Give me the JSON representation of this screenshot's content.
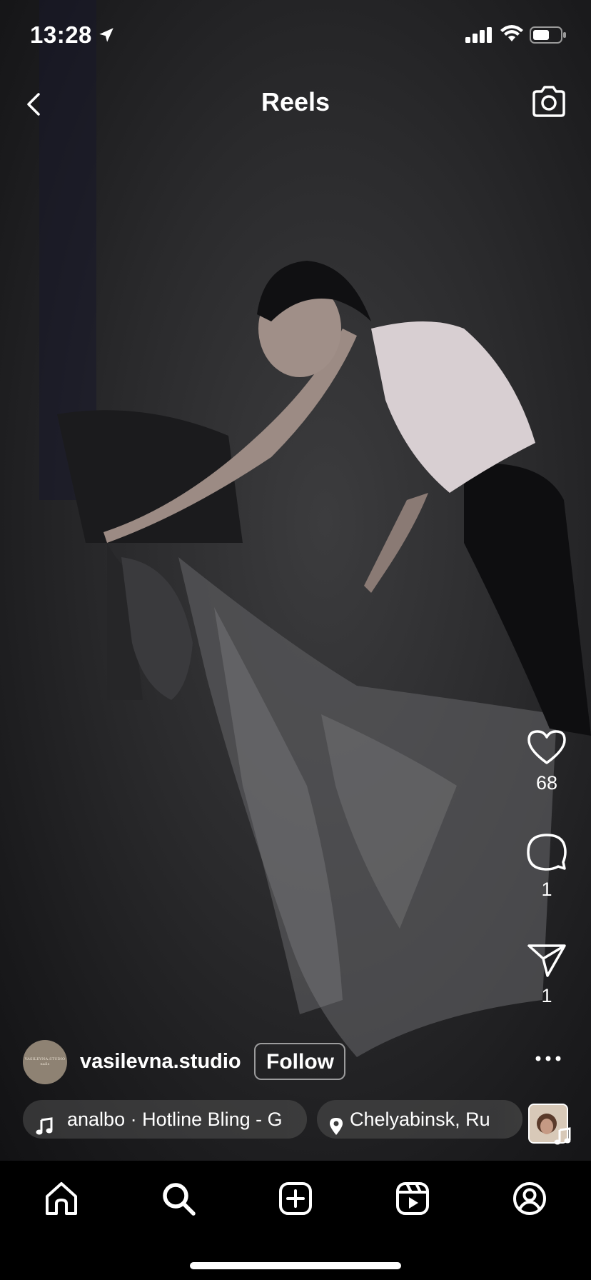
{
  "status_bar": {
    "time": "13:28",
    "icons": [
      "location-arrow-icon",
      "cellular-signal-icon",
      "wifi-icon",
      "battery-icon"
    ]
  },
  "header": {
    "title": "Reels",
    "back_icon": "chevron-left-icon",
    "camera_icon": "camera-icon"
  },
  "actions": {
    "likes": "68",
    "comments": "1",
    "shares": "1",
    "more_icon": "more-horizontal-icon"
  },
  "author": {
    "avatar_text": "VASILEVNA.STUDIO nails",
    "username": "vasilevna.studio",
    "follow_label": "Follow"
  },
  "audio": {
    "text": "analbo · Hotline Bling - G"
  },
  "location": {
    "text": "Chelyabinsk, Ru"
  },
  "nav": {
    "items": [
      "home-icon",
      "search-icon",
      "create-icon",
      "reels-icon",
      "profile-icon"
    ],
    "active": "search-icon"
  },
  "colors": {
    "background": "#000000",
    "text": "#ffffff",
    "chip": "#505050"
  }
}
